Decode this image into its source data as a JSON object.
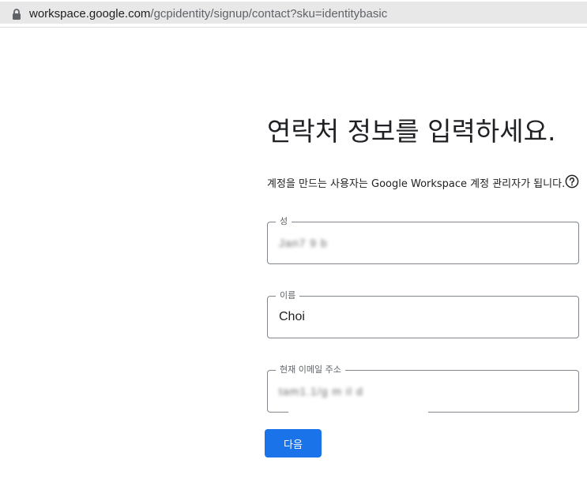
{
  "browser": {
    "url_host": "workspace.google.com",
    "url_path": "/gcpidentity/signup/contact?sku=identitybasic",
    "lock_icon": "lock-icon"
  },
  "page": {
    "title": "연락처 정보를 입력하세요.",
    "subtitle": "계정을 만드는 사용자는 Google Workspace 계정 관리자가 됩니다.",
    "help_icon": "help-circle-icon"
  },
  "form": {
    "last_name": {
      "label": "성",
      "value": "Jan7 9 b"
    },
    "first_name": {
      "label": "이름",
      "value": "Choi"
    },
    "email": {
      "label": "현재 이메일 주소",
      "value": "tam1.1/g m il d"
    },
    "next_label": "다음"
  },
  "colors": {
    "accent": "#1a73e8",
    "border": "#80868b",
    "label": "#5f6368",
    "text": "#202124",
    "urlbar_bg": "#e8e8e8"
  }
}
